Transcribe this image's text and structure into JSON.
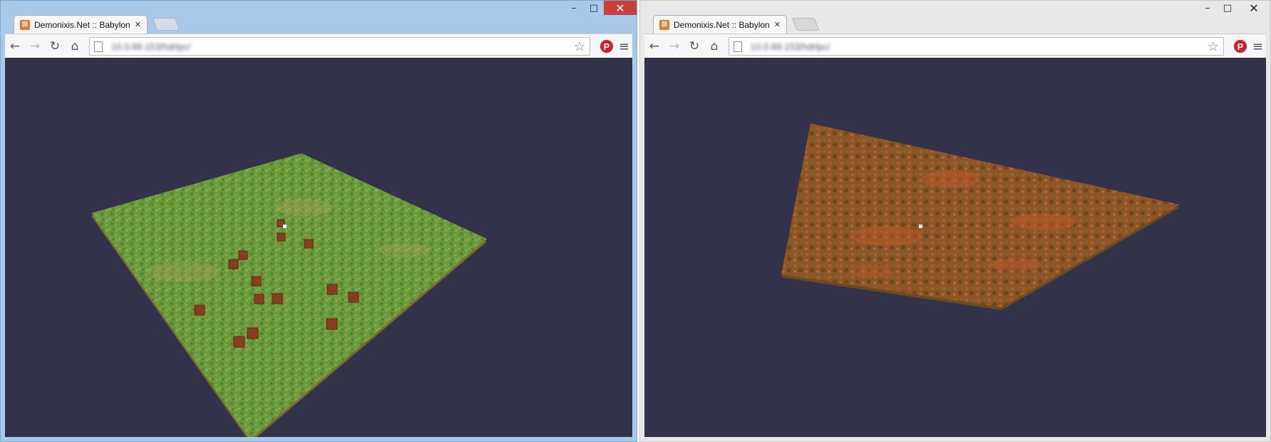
{
  "windows": [
    {
      "tab": {
        "title": "Demonixis.Net :: Babylon.j",
        "close": "✕"
      },
      "url": "10.0.69.153/hdrlpc/",
      "caption": {
        "minimize": "–",
        "maximize": "□",
        "close": "✕"
      },
      "scene": "Babylon.js scene: grass ground plane with brown boxes"
    },
    {
      "tab": {
        "title": "Demonixis.Net :: Babylon.j",
        "close": "✕"
      },
      "url": "10.0.69.153/hdrlpc/",
      "caption": {
        "minimize": "–",
        "maximize": "□",
        "close": "✕"
      },
      "scene": "Babylon.js scene: reddish-brown textured plane"
    }
  ],
  "icons": {
    "back": "back-arrow-icon",
    "forward": "forward-arrow-icon",
    "reload": "reload-icon",
    "home": "home-icon",
    "bookmark": "star-icon",
    "pinterest": "pinterest-icon",
    "menu": "hamburger-menu-icon"
  },
  "colors": {
    "canvas_bg": "#33324b",
    "grass": "#6b9a3a",
    "dirt": "#8a4f22",
    "box": "#8a3d1c",
    "close_btn_active": "#c7413a",
    "active_frame": "#a9c9e8"
  }
}
